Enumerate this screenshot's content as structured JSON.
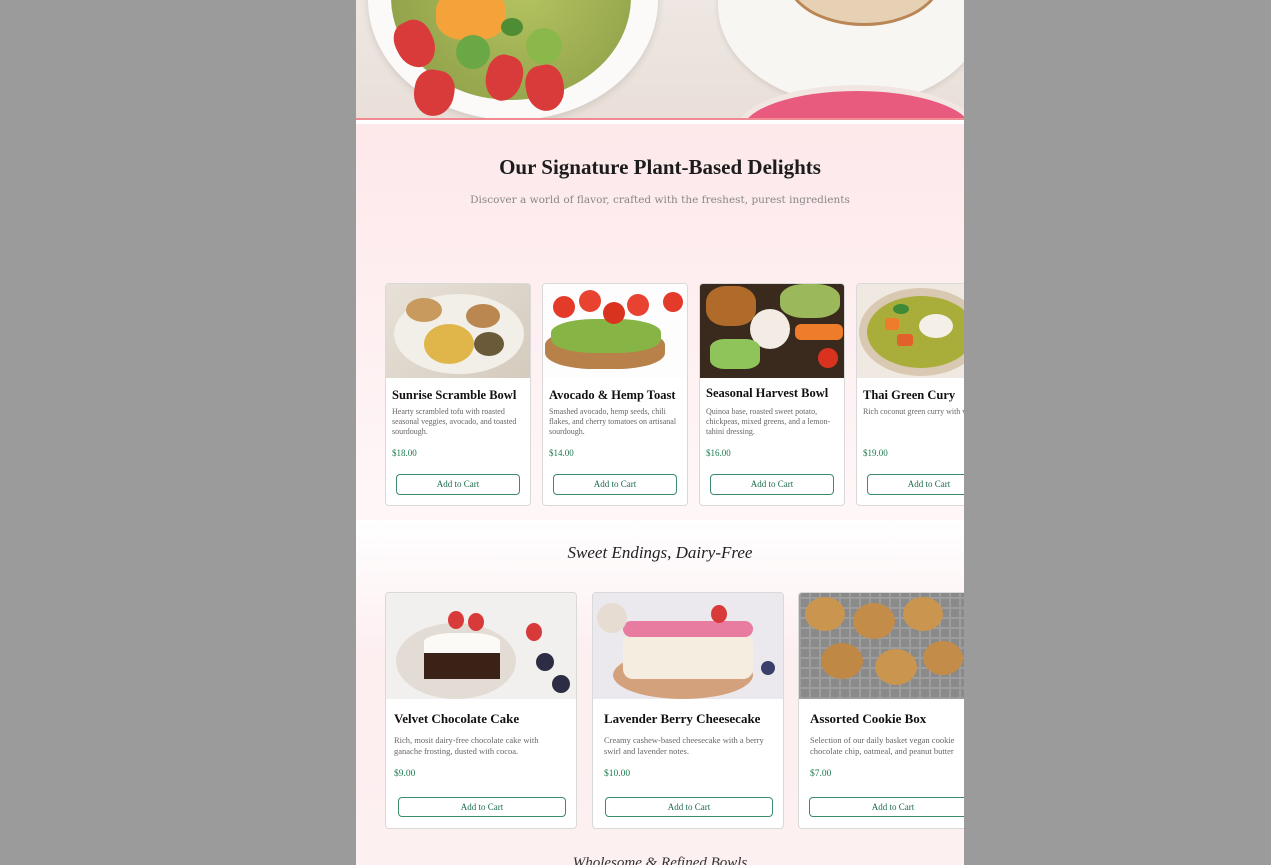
{
  "signature": {
    "title": "Our Signature Plant-Based Delights",
    "subtitle": "Discover a world of flavor, crafted with the freshest, purest ingredients"
  },
  "savory_items": [
    {
      "name": "Sunrise Scramble Bowl",
      "desc": "Hearty scrambled tofu with roasted seasonal veggies, avocado, and toasted sourdough.",
      "price": "$18.00",
      "button": "Add to Cart"
    },
    {
      "name": "Avocado & Hemp Toast",
      "desc": "Smashed avocado, hemp seeds, chili flakes, and cherry tomatoes on artisanal sourdough.",
      "price": "$14.00",
      "button": "Add to Cart"
    },
    {
      "name": "Seasonal Harvest Bowl",
      "desc": "Quinoa base, roasted sweet potato, chickpeas, mixed greens, and a lemon-tahini dressing.",
      "price": "$16.00",
      "button": "Add to Cart"
    },
    {
      "name": "Thai Green Cury",
      "desc": "Rich coconut green curry with vegetales and aromatic jasmine",
      "price": "$19.00",
      "button": "Add to Cart"
    }
  ],
  "sweet": {
    "title": "Sweet Endings, Dairy-Free"
  },
  "sweet_items": [
    {
      "name": "Velvet Chocolate Cake",
      "desc": "Rich, mosit dairy-free chocolate cake with ganache frosting, dusted with cocoa.",
      "price": "$9.00",
      "button": "Add to Cart"
    },
    {
      "name": "Lavender Berry Cheesecake",
      "desc": "Creamy cashew-based cheesecake with a berry swirl and lavender notes.",
      "price": "$10.00",
      "button": "Add to Cart"
    },
    {
      "name": "Assorted Cookie Box",
      "desc": "Selection of our daily basket vegan cookie chocolate chip, oatmeal, and peanut butter",
      "price": "$7.00",
      "button": "Add to Cart"
    }
  ],
  "next_section": {
    "title": "Wholesome & Refined Bowls"
  },
  "colors": {
    "accent_pink": "#f08a93",
    "price_green": "#1a7a4c",
    "button_border": "#3c8c6a"
  }
}
